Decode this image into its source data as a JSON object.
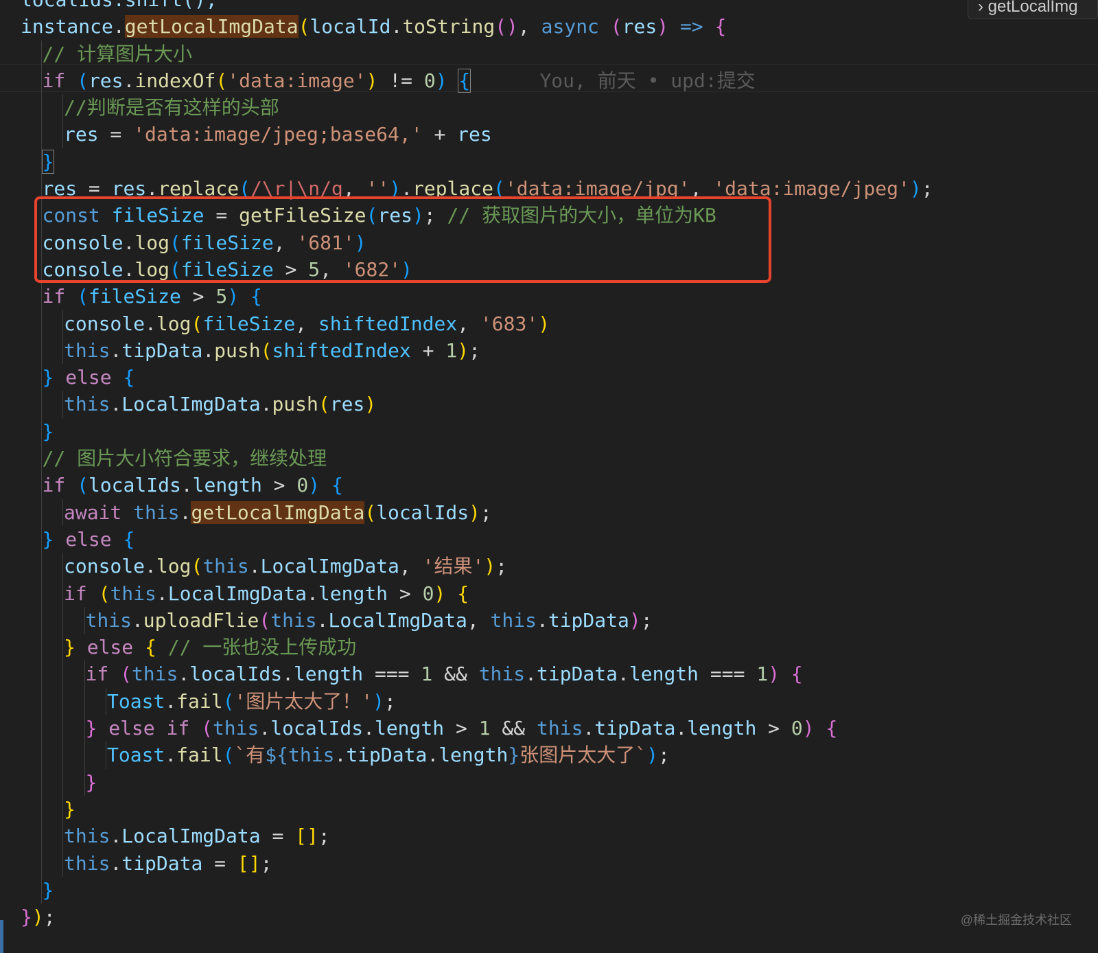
{
  "editor": {
    "breadcrumb": "getLocalImg",
    "watermark": "@稀土掘金技术社区",
    "blame": "You, 前天 • upd:提交",
    "lines": [
      [
        {
          "t": "localIds.shift();",
          "c": "var"
        }
      ],
      [
        {
          "t": "instance",
          "c": "var"
        },
        {
          "t": ".",
          "c": "plain"
        },
        {
          "t": "getLocalImgData",
          "c": "fn hl"
        },
        {
          "t": "(",
          "c": "b1"
        },
        {
          "t": "localId",
          "c": "var"
        },
        {
          "t": ".",
          "c": "plain"
        },
        {
          "t": "toString",
          "c": "fn"
        },
        {
          "t": "()",
          "c": "b2"
        },
        {
          "t": ", ",
          "c": "plain"
        },
        {
          "t": "async",
          "c": "kw"
        },
        {
          "t": " ",
          "c": "plain"
        },
        {
          "t": "(",
          "c": "b2"
        },
        {
          "t": "res",
          "c": "var"
        },
        {
          "t": ")",
          "c": "b2"
        },
        {
          "t": " ",
          "c": "plain"
        },
        {
          "t": "=>",
          "c": "kw"
        },
        {
          "t": " ",
          "c": "plain"
        },
        {
          "t": "{",
          "c": "b2"
        }
      ],
      [
        {
          "t": "// 计算图片大小",
          "c": "cmt"
        }
      ],
      [
        {
          "t": "if",
          "c": "ctrl"
        },
        {
          "t": " ",
          "c": "plain"
        },
        {
          "t": "(",
          "c": "b3"
        },
        {
          "t": "res",
          "c": "var"
        },
        {
          "t": ".",
          "c": "plain"
        },
        {
          "t": "indexOf",
          "c": "fn"
        },
        {
          "t": "(",
          "c": "b1"
        },
        {
          "t": "'data:image'",
          "c": "str"
        },
        {
          "t": ")",
          "c": "b1"
        },
        {
          "t": " != ",
          "c": "plain"
        },
        {
          "t": "0",
          "c": "num"
        },
        {
          "t": ")",
          "c": "b3"
        },
        {
          "t": " ",
          "c": "plain"
        },
        {
          "t": "{",
          "c": "b3 brmatch"
        },
        {
          "t": "      ",
          "c": "plain"
        },
        {
          "t": "You, 前天 • upd:提交",
          "c": "blame"
        }
      ],
      [
        {
          "t": "//判断是否有这样的头部",
          "c": "cmt"
        }
      ],
      [
        {
          "t": "res",
          "c": "var"
        },
        {
          "t": " = ",
          "c": "plain"
        },
        {
          "t": "'data:image/jpeg;base64,'",
          "c": "str"
        },
        {
          "t": " + ",
          "c": "plain"
        },
        {
          "t": "res",
          "c": "var"
        }
      ],
      [
        {
          "t": "}",
          "c": "b3 brmatch"
        }
      ],
      [
        {
          "t": "res",
          "c": "var"
        },
        {
          "t": " = ",
          "c": "plain"
        },
        {
          "t": "res",
          "c": "var"
        },
        {
          "t": ".",
          "c": "plain"
        },
        {
          "t": "replace",
          "c": "fn"
        },
        {
          "t": "(",
          "c": "b3"
        },
        {
          "t": "/\\r|\\n/g",
          "c": "rx"
        },
        {
          "t": ", ",
          "c": "plain"
        },
        {
          "t": "''",
          "c": "str"
        },
        {
          "t": ")",
          "c": "b3"
        },
        {
          "t": ".",
          "c": "plain"
        },
        {
          "t": "replace",
          "c": "fn"
        },
        {
          "t": "(",
          "c": "b3"
        },
        {
          "t": "'data:image/jpg'",
          "c": "str"
        },
        {
          "t": ", ",
          "c": "plain"
        },
        {
          "t": "'data:image/jpeg'",
          "c": "str"
        },
        {
          "t": ")",
          "c": "b3"
        },
        {
          "t": ";",
          "c": "plain"
        }
      ],
      [
        {
          "t": "const",
          "c": "kw"
        },
        {
          "t": " ",
          "c": "plain"
        },
        {
          "t": "fileSize",
          "c": "const"
        },
        {
          "t": " = ",
          "c": "plain"
        },
        {
          "t": "getFileSize",
          "c": "fn"
        },
        {
          "t": "(",
          "c": "b3"
        },
        {
          "t": "res",
          "c": "var"
        },
        {
          "t": ")",
          "c": "b3"
        },
        {
          "t": "; ",
          "c": "plain"
        },
        {
          "t": "// 获取图片的大小，单位为KB",
          "c": "cmt"
        }
      ],
      [
        {
          "t": "console",
          "c": "var"
        },
        {
          "t": ".",
          "c": "plain"
        },
        {
          "t": "log",
          "c": "fn"
        },
        {
          "t": "(",
          "c": "b3"
        },
        {
          "t": "fileSize",
          "c": "const"
        },
        {
          "t": ", ",
          "c": "plain"
        },
        {
          "t": "'681'",
          "c": "str"
        },
        {
          "t": ")",
          "c": "b3"
        }
      ],
      [
        {
          "t": "console",
          "c": "var"
        },
        {
          "t": ".",
          "c": "plain"
        },
        {
          "t": "log",
          "c": "fn"
        },
        {
          "t": "(",
          "c": "b3"
        },
        {
          "t": "fileSize",
          "c": "const"
        },
        {
          "t": " > ",
          "c": "plain"
        },
        {
          "t": "5",
          "c": "num"
        },
        {
          "t": ", ",
          "c": "plain"
        },
        {
          "t": "'682'",
          "c": "str"
        },
        {
          "t": ")",
          "c": "b3"
        }
      ],
      [
        {
          "t": "if",
          "c": "ctrl"
        },
        {
          "t": " ",
          "c": "plain"
        },
        {
          "t": "(",
          "c": "b3"
        },
        {
          "t": "fileSize",
          "c": "const"
        },
        {
          "t": " > ",
          "c": "plain"
        },
        {
          "t": "5",
          "c": "num"
        },
        {
          "t": ")",
          "c": "b3"
        },
        {
          "t": " ",
          "c": "plain"
        },
        {
          "t": "{",
          "c": "b3"
        }
      ],
      [
        {
          "t": "console",
          "c": "var"
        },
        {
          "t": ".",
          "c": "plain"
        },
        {
          "t": "log",
          "c": "fn"
        },
        {
          "t": "(",
          "c": "b1"
        },
        {
          "t": "fileSize",
          "c": "const"
        },
        {
          "t": ", ",
          "c": "plain"
        },
        {
          "t": "shiftedIndex",
          "c": "const"
        },
        {
          "t": ", ",
          "c": "plain"
        },
        {
          "t": "'683'",
          "c": "str"
        },
        {
          "t": ")",
          "c": "b1"
        }
      ],
      [
        {
          "t": "this",
          "c": "kw"
        },
        {
          "t": ".",
          "c": "plain"
        },
        {
          "t": "tipData",
          "c": "var"
        },
        {
          "t": ".",
          "c": "plain"
        },
        {
          "t": "push",
          "c": "fn"
        },
        {
          "t": "(",
          "c": "b1"
        },
        {
          "t": "shiftedIndex",
          "c": "const"
        },
        {
          "t": " + ",
          "c": "plain"
        },
        {
          "t": "1",
          "c": "num"
        },
        {
          "t": ")",
          "c": "b1"
        },
        {
          "t": ";",
          "c": "plain"
        }
      ],
      [
        {
          "t": "}",
          "c": "b3"
        },
        {
          "t": " ",
          "c": "plain"
        },
        {
          "t": "else",
          "c": "ctrl"
        },
        {
          "t": " ",
          "c": "plain"
        },
        {
          "t": "{",
          "c": "b3"
        }
      ],
      [
        {
          "t": "this",
          "c": "kw"
        },
        {
          "t": ".",
          "c": "plain"
        },
        {
          "t": "LocalImgData",
          "c": "var"
        },
        {
          "t": ".",
          "c": "plain"
        },
        {
          "t": "push",
          "c": "fn"
        },
        {
          "t": "(",
          "c": "b1"
        },
        {
          "t": "res",
          "c": "var"
        },
        {
          "t": ")",
          "c": "b1"
        }
      ],
      [
        {
          "t": "}",
          "c": "b3"
        }
      ],
      [
        {
          "t": "// 图片大小符合要求，继续处理",
          "c": "cmt"
        }
      ],
      [
        {
          "t": "if",
          "c": "ctrl"
        },
        {
          "t": " ",
          "c": "plain"
        },
        {
          "t": "(",
          "c": "b3"
        },
        {
          "t": "localIds",
          "c": "var"
        },
        {
          "t": ".",
          "c": "plain"
        },
        {
          "t": "length",
          "c": "var"
        },
        {
          "t": " > ",
          "c": "plain"
        },
        {
          "t": "0",
          "c": "num"
        },
        {
          "t": ")",
          "c": "b3"
        },
        {
          "t": " ",
          "c": "plain"
        },
        {
          "t": "{",
          "c": "b3"
        }
      ],
      [
        {
          "t": "await",
          "c": "ctrl"
        },
        {
          "t": " ",
          "c": "plain"
        },
        {
          "t": "this",
          "c": "kw"
        },
        {
          "t": ".",
          "c": "plain"
        },
        {
          "t": "getLocalImgData",
          "c": "fn hl"
        },
        {
          "t": "(",
          "c": "b1"
        },
        {
          "t": "localIds",
          "c": "var"
        },
        {
          "t": ")",
          "c": "b1"
        },
        {
          "t": ";",
          "c": "plain"
        }
      ],
      [
        {
          "t": "}",
          "c": "b3"
        },
        {
          "t": " ",
          "c": "plain"
        },
        {
          "t": "else",
          "c": "ctrl"
        },
        {
          "t": " ",
          "c": "plain"
        },
        {
          "t": "{",
          "c": "b3"
        }
      ],
      [
        {
          "t": "console",
          "c": "var"
        },
        {
          "t": ".",
          "c": "plain"
        },
        {
          "t": "log",
          "c": "fn"
        },
        {
          "t": "(",
          "c": "b1"
        },
        {
          "t": "this",
          "c": "kw"
        },
        {
          "t": ".",
          "c": "plain"
        },
        {
          "t": "LocalImgData",
          "c": "var"
        },
        {
          "t": ", ",
          "c": "plain"
        },
        {
          "t": "'结果'",
          "c": "str"
        },
        {
          "t": ")",
          "c": "b1"
        },
        {
          "t": ";",
          "c": "plain"
        }
      ],
      [
        {
          "t": "if",
          "c": "ctrl"
        },
        {
          "t": " ",
          "c": "plain"
        },
        {
          "t": "(",
          "c": "b1"
        },
        {
          "t": "this",
          "c": "kw"
        },
        {
          "t": ".",
          "c": "plain"
        },
        {
          "t": "LocalImgData",
          "c": "var"
        },
        {
          "t": ".",
          "c": "plain"
        },
        {
          "t": "length",
          "c": "var"
        },
        {
          "t": " > ",
          "c": "plain"
        },
        {
          "t": "0",
          "c": "num"
        },
        {
          "t": ")",
          "c": "b1"
        },
        {
          "t": " ",
          "c": "plain"
        },
        {
          "t": "{",
          "c": "b1"
        }
      ],
      [
        {
          "t": "this",
          "c": "kw"
        },
        {
          "t": ".",
          "c": "plain"
        },
        {
          "t": "uploadFlie",
          "c": "fn"
        },
        {
          "t": "(",
          "c": "b2"
        },
        {
          "t": "this",
          "c": "kw"
        },
        {
          "t": ".",
          "c": "plain"
        },
        {
          "t": "LocalImgData",
          "c": "var"
        },
        {
          "t": ", ",
          "c": "plain"
        },
        {
          "t": "this",
          "c": "kw"
        },
        {
          "t": ".",
          "c": "plain"
        },
        {
          "t": "tipData",
          "c": "var"
        },
        {
          "t": ")",
          "c": "b2"
        },
        {
          "t": ";",
          "c": "plain"
        }
      ],
      [
        {
          "t": "}",
          "c": "b1"
        },
        {
          "t": " ",
          "c": "plain"
        },
        {
          "t": "else",
          "c": "ctrl"
        },
        {
          "t": " ",
          "c": "plain"
        },
        {
          "t": "{",
          "c": "b1"
        },
        {
          "t": " ",
          "c": "plain"
        },
        {
          "t": "// 一张也没上传成功",
          "c": "cmt"
        }
      ],
      [
        {
          "t": "if",
          "c": "ctrl"
        },
        {
          "t": " ",
          "c": "plain"
        },
        {
          "t": "(",
          "c": "b2"
        },
        {
          "t": "this",
          "c": "kw"
        },
        {
          "t": ".",
          "c": "plain"
        },
        {
          "t": "localIds",
          "c": "var"
        },
        {
          "t": ".",
          "c": "plain"
        },
        {
          "t": "length",
          "c": "var"
        },
        {
          "t": " === ",
          "c": "plain"
        },
        {
          "t": "1",
          "c": "num"
        },
        {
          "t": " && ",
          "c": "plain"
        },
        {
          "t": "this",
          "c": "kw"
        },
        {
          "t": ".",
          "c": "plain"
        },
        {
          "t": "tipData",
          "c": "var"
        },
        {
          "t": ".",
          "c": "plain"
        },
        {
          "t": "length",
          "c": "var"
        },
        {
          "t": " === ",
          "c": "plain"
        },
        {
          "t": "1",
          "c": "num"
        },
        {
          "t": ")",
          "c": "b2"
        },
        {
          "t": " ",
          "c": "plain"
        },
        {
          "t": "{",
          "c": "b2"
        }
      ],
      [
        {
          "t": "Toast",
          "c": "const"
        },
        {
          "t": ".",
          "c": "plain"
        },
        {
          "t": "fail",
          "c": "fn"
        },
        {
          "t": "(",
          "c": "b3"
        },
        {
          "t": "'图片太大了！'",
          "c": "str"
        },
        {
          "t": ")",
          "c": "b3"
        },
        {
          "t": ";",
          "c": "plain"
        }
      ],
      [
        {
          "t": "}",
          "c": "b2"
        },
        {
          "t": " ",
          "c": "plain"
        },
        {
          "t": "else",
          "c": "ctrl"
        },
        {
          "t": " ",
          "c": "plain"
        },
        {
          "t": "if",
          "c": "ctrl"
        },
        {
          "t": " ",
          "c": "plain"
        },
        {
          "t": "(",
          "c": "b2"
        },
        {
          "t": "this",
          "c": "kw"
        },
        {
          "t": ".",
          "c": "plain"
        },
        {
          "t": "localIds",
          "c": "var"
        },
        {
          "t": ".",
          "c": "plain"
        },
        {
          "t": "length",
          "c": "var"
        },
        {
          "t": " > ",
          "c": "plain"
        },
        {
          "t": "1",
          "c": "num"
        },
        {
          "t": " && ",
          "c": "plain"
        },
        {
          "t": "this",
          "c": "kw"
        },
        {
          "t": ".",
          "c": "plain"
        },
        {
          "t": "tipData",
          "c": "var"
        },
        {
          "t": ".",
          "c": "plain"
        },
        {
          "t": "length",
          "c": "var"
        },
        {
          "t": " > ",
          "c": "plain"
        },
        {
          "t": "0",
          "c": "num"
        },
        {
          "t": ")",
          "c": "b2"
        },
        {
          "t": " ",
          "c": "plain"
        },
        {
          "t": "{",
          "c": "b2"
        }
      ],
      [
        {
          "t": "Toast",
          "c": "const"
        },
        {
          "t": ".",
          "c": "plain"
        },
        {
          "t": "fail",
          "c": "fn"
        },
        {
          "t": "(",
          "c": "b3"
        },
        {
          "t": "`有",
          "c": "str"
        },
        {
          "t": "${",
          "c": "kw"
        },
        {
          "t": "this",
          "c": "kw"
        },
        {
          "t": ".",
          "c": "plain"
        },
        {
          "t": "tipData",
          "c": "var"
        },
        {
          "t": ".",
          "c": "plain"
        },
        {
          "t": "length",
          "c": "var"
        },
        {
          "t": "}",
          "c": "kw"
        },
        {
          "t": "张图片太大了`",
          "c": "str"
        },
        {
          "t": ")",
          "c": "b3"
        },
        {
          "t": ";",
          "c": "plain"
        }
      ],
      [
        {
          "t": "}",
          "c": "b2"
        }
      ],
      [
        {
          "t": "}",
          "c": "b1"
        }
      ],
      [
        {
          "t": "this",
          "c": "kw"
        },
        {
          "t": ".",
          "c": "plain"
        },
        {
          "t": "LocalImgData",
          "c": "var"
        },
        {
          "t": " = ",
          "c": "plain"
        },
        {
          "t": "[]",
          "c": "b1"
        },
        {
          "t": ";",
          "c": "plain"
        }
      ],
      [
        {
          "t": "this",
          "c": "kw"
        },
        {
          "t": ".",
          "c": "plain"
        },
        {
          "t": "tipData",
          "c": "var"
        },
        {
          "t": " = ",
          "c": "plain"
        },
        {
          "t": "[]",
          "c": "b1"
        },
        {
          "t": ";",
          "c": "plain"
        }
      ],
      [
        {
          "t": "}",
          "c": "b3"
        }
      ],
      [
        {
          "t": "}",
          "c": "b2"
        },
        {
          "t": ")",
          "c": "b1"
        },
        {
          "t": ";",
          "c": "plain"
        }
      ]
    ]
  }
}
